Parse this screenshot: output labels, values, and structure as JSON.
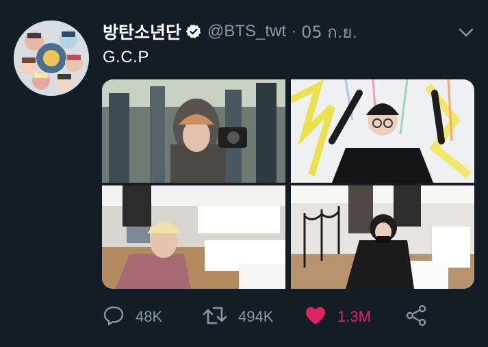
{
  "tweet": {
    "display_name": "방탄소년단",
    "handle": "@BTS_twt",
    "separator": "·",
    "time": "05 ก.ย.",
    "text": "G.C.P",
    "verified": true
  },
  "media": {
    "count": 4,
    "photos": [
      {
        "description_icon": "photo-mirror-selfie-camera"
      },
      {
        "description_icon": "photo-paint-splatter-wall"
      },
      {
        "description_icon": "photo-gallery-benches"
      },
      {
        "description_icon": "photo-gallery-rope-barrier"
      }
    ]
  },
  "actions": {
    "reply_count": "48K",
    "retweet_count": "494K",
    "like_count": "1.3M",
    "liked": true
  },
  "colors": {
    "background": "#141d26",
    "secondary_text": "#8899a6",
    "like": "#e0245e",
    "verified_badge": "#ffffff"
  }
}
